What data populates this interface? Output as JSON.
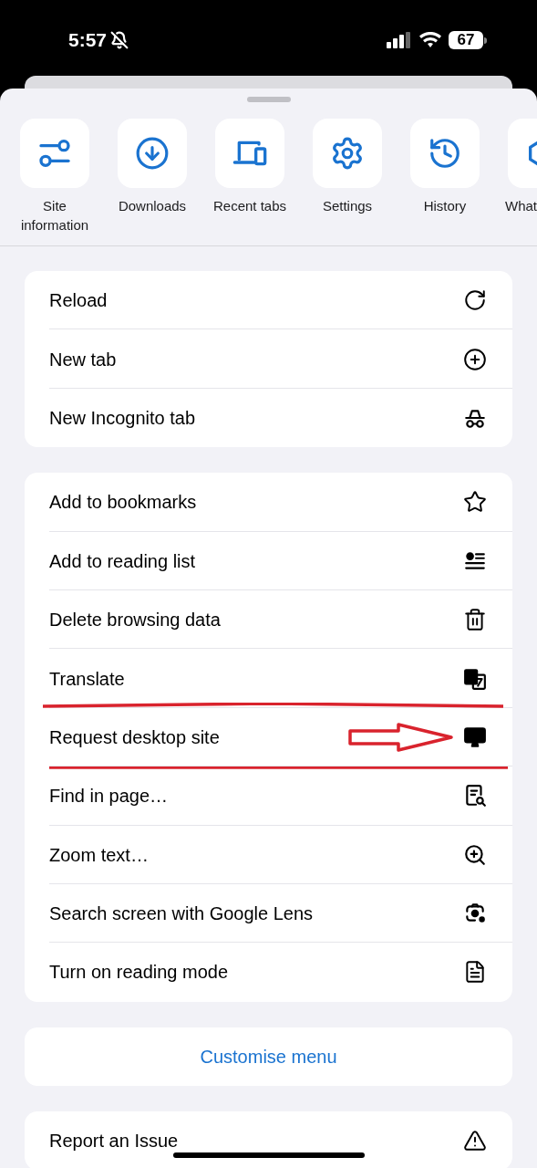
{
  "status_bar": {
    "time": "5:57",
    "battery": "67"
  },
  "quick_actions": [
    {
      "label": "Site information"
    },
    {
      "label": "Downloads"
    },
    {
      "label": "Recent tabs"
    },
    {
      "label": "Settings"
    },
    {
      "label": "History"
    },
    {
      "label": "What"
    }
  ],
  "menu_groups": [
    {
      "items": [
        {
          "label": "Reload",
          "highlighted": false
        },
        {
          "label": "New tab",
          "highlighted": false
        },
        {
          "label": "New Incognito tab",
          "highlighted": false
        }
      ]
    },
    {
      "items": [
        {
          "label": "Add to bookmarks",
          "highlighted": false
        },
        {
          "label": "Add to reading list",
          "highlighted": false
        },
        {
          "label": "Delete browsing data",
          "highlighted": false
        },
        {
          "label": "Translate",
          "highlighted": false
        },
        {
          "label": "Request desktop site",
          "highlighted": true
        },
        {
          "label": "Find in page…",
          "highlighted": false
        },
        {
          "label": "Zoom text…",
          "highlighted": false
        },
        {
          "label": "Search screen with Google Lens",
          "highlighted": false
        },
        {
          "label": "Turn on reading mode",
          "highlighted": false
        }
      ]
    }
  ],
  "customise_button": "Customise menu",
  "report_item": {
    "label": "Report an Issue"
  }
}
